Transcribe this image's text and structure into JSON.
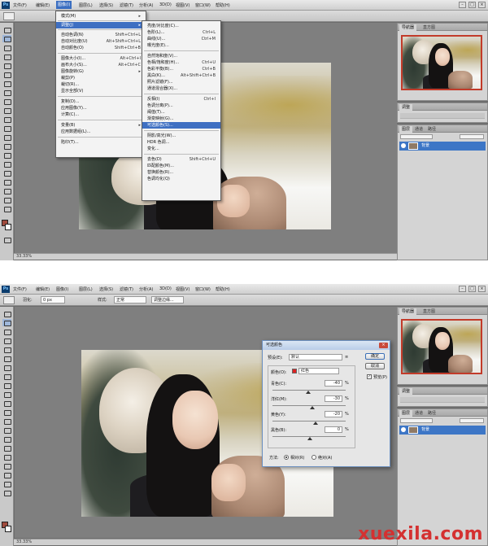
{
  "top": {
    "menubar": {
      "items": [
        "文件(F)",
        "编辑(E)",
        "图像(I)",
        "图层(L)",
        "选择(S)",
        "滤镜(T)",
        "分析(A)",
        "3D(D)",
        "视图(V)",
        "窗口(W)",
        "帮助(H)"
      ],
      "active_index": 2
    },
    "image_menu": {
      "items": [
        {
          "label": "模式(M)",
          "shortcut": "▸"
        },
        {
          "label": "调整(J)",
          "shortcut": "▸"
        },
        {
          "label": "自动色调(N)",
          "shortcut": "Shift+Ctrl+L"
        },
        {
          "label": "自动对比度(U)",
          "shortcut": "Alt+Shift+Ctrl+L"
        },
        {
          "label": "自动颜色(O)",
          "shortcut": "Shift+Ctrl+B"
        },
        {
          "label": "图像大小(I)...",
          "shortcut": "Alt+Ctrl+I"
        },
        {
          "label": "画布大小(S)...",
          "shortcut": "Alt+Ctrl+C"
        },
        {
          "label": "图像旋转(G)",
          "shortcut": "▸"
        },
        {
          "label": "裁剪(P)",
          "shortcut": ""
        },
        {
          "label": "裁切(R)...",
          "shortcut": ""
        },
        {
          "label": "显示全部(V)",
          "shortcut": ""
        },
        {
          "label": "复制(D)...",
          "shortcut": ""
        },
        {
          "label": "应用图像(Y)...",
          "shortcut": ""
        },
        {
          "label": "计算(C)...",
          "shortcut": ""
        },
        {
          "label": "变量(B)",
          "shortcut": "▸"
        },
        {
          "label": "应用数据组(L)...",
          "shortcut": ""
        },
        {
          "label": "陷印(T)...",
          "shortcut": ""
        }
      ]
    },
    "adjust_menu": {
      "items": [
        {
          "label": "亮度/对比度(C)...",
          "shortcut": ""
        },
        {
          "label": "色阶(L)...",
          "shortcut": "Ctrl+L"
        },
        {
          "label": "曲线(U)...",
          "shortcut": "Ctrl+M"
        },
        {
          "label": "曝光度(E)...",
          "shortcut": ""
        },
        {
          "label": "自然饱和度(V)...",
          "shortcut": ""
        },
        {
          "label": "色相/饱和度(H)...",
          "shortcut": "Ctrl+U"
        },
        {
          "label": "色彩平衡(B)...",
          "shortcut": "Ctrl+B"
        },
        {
          "label": "黑白(K)...",
          "shortcut": "Alt+Shift+Ctrl+B"
        },
        {
          "label": "照片滤镜(F)...",
          "shortcut": ""
        },
        {
          "label": "通道混合器(X)...",
          "shortcut": ""
        },
        {
          "label": "反相(I)",
          "shortcut": "Ctrl+I"
        },
        {
          "label": "色调分离(P)...",
          "shortcut": ""
        },
        {
          "label": "阈值(T)...",
          "shortcut": ""
        },
        {
          "label": "渐变映射(G)...",
          "shortcut": ""
        },
        {
          "label": "可选颜色(S)...",
          "shortcut": ""
        },
        {
          "label": "阴影/高光(W)...",
          "shortcut": ""
        },
        {
          "label": "HDR 色调...",
          "shortcut": ""
        },
        {
          "label": "变化...",
          "shortcut": ""
        },
        {
          "label": "去色(D)",
          "shortcut": "Shift+Ctrl+U"
        },
        {
          "label": "匹配颜色(M)...",
          "shortcut": ""
        },
        {
          "label": "替换颜色(R)...",
          "shortcut": ""
        },
        {
          "label": "色调均化(Q)",
          "shortcut": ""
        }
      ],
      "highlighted_index": 14
    },
    "layers": {
      "layer_name": "背景"
    },
    "status": "33.33%"
  },
  "bottom": {
    "menubar": {
      "items": [
        "文件(F)",
        "编辑(E)",
        "图像(I)",
        "图层(L)",
        "选择(S)",
        "滤镜(T)",
        "分析(A)",
        "3D(D)",
        "视图(V)",
        "窗口(W)",
        "帮助(H)"
      ]
    },
    "options": {
      "feather_label": "羽化:",
      "feather_value": "0 px",
      "style_label": "样式:",
      "style_value": "正常",
      "refine_label": "调整边缘..."
    },
    "dialog": {
      "title": "可选颜色",
      "preset_label": "预设(E):",
      "preset_value": "默认",
      "colors_label": "颜色(O):",
      "colors_value": "红色",
      "ok": "确定",
      "cancel": "取消",
      "preview": "预览(P)",
      "sliders": [
        {
          "label": "青色(C):",
          "value": "-40",
          "unit": "%"
        },
        {
          "label": "洋红(M):",
          "value": "-30",
          "unit": "%"
        },
        {
          "label": "黄色(Y):",
          "value": "-20",
          "unit": "%"
        },
        {
          "label": "黑色(B):",
          "value": "0",
          "unit": "%"
        }
      ],
      "method_label": "方法:",
      "method_relative": "相对(R)",
      "method_absolute": "绝对(A)"
    },
    "layers": {
      "layer_name": "背景"
    },
    "status": "33.33%"
  },
  "watermark": "xuexila.com"
}
